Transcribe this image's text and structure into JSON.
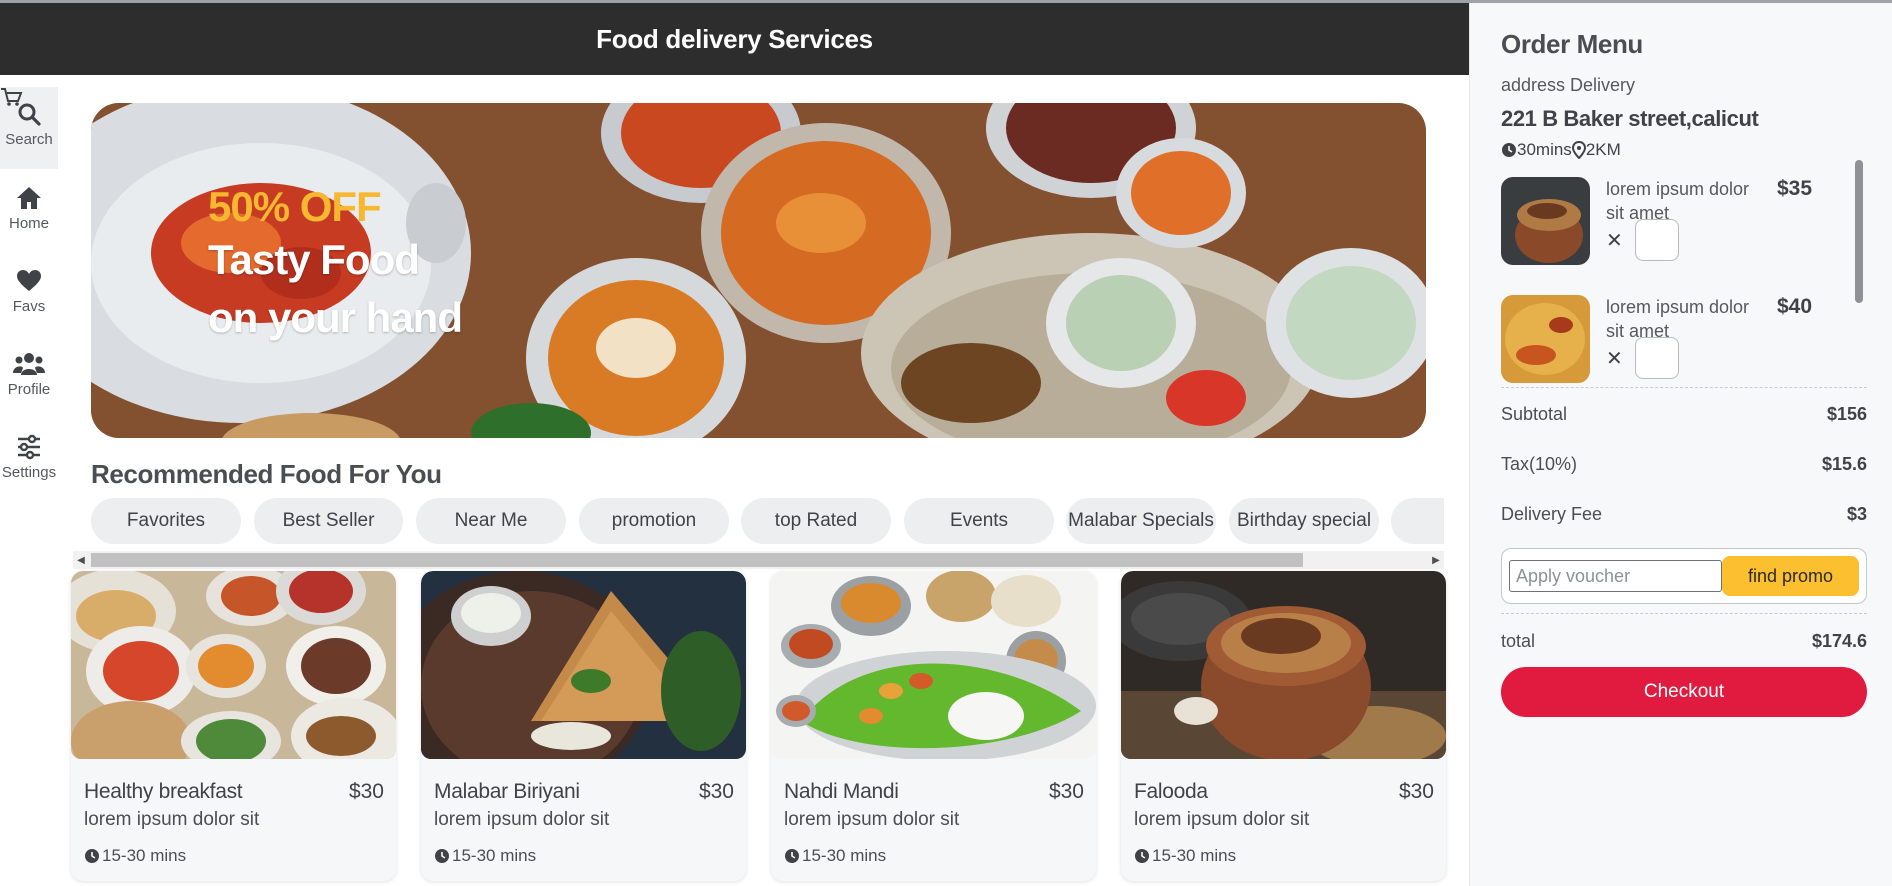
{
  "header": {
    "title": "Food delivery Services"
  },
  "nav": [
    {
      "label": "Search",
      "icon": "search-icon"
    },
    {
      "label": "Home",
      "icon": "home-icon"
    },
    {
      "label": "Favs",
      "icon": "heart-icon"
    },
    {
      "label": "Profile",
      "icon": "users-icon"
    },
    {
      "label": "Settings",
      "icon": "sliders-icon"
    }
  ],
  "banner": {
    "offer": "50% OFF",
    "line1": "Tasty Food",
    "line2": "on your hand"
  },
  "recommended": {
    "title": "Recommended Food For You",
    "categories": [
      "Favorites",
      "Best Seller",
      "Near Me",
      "promotion",
      "top Rated",
      "Events",
      "Malabar Specials",
      "Birthday special",
      ""
    ]
  },
  "foods": [
    {
      "name": "Healthy breakfast",
      "price": "$30",
      "desc": "lorem ipsum dolor sit",
      "time": "15-30 mins"
    },
    {
      "name": "Malabar Biriyani",
      "price": "$30",
      "desc": "lorem ipsum dolor sit",
      "time": "15-30 mins"
    },
    {
      "name": "Nahdi Mandi",
      "price": "$30",
      "desc": "lorem ipsum dolor sit",
      "time": "15-30 mins"
    },
    {
      "name": "Falooda",
      "price": "$30",
      "desc": "lorem ipsum dolor sit",
      "time": "15-30 mins"
    }
  ],
  "order": {
    "title": "Order Menu",
    "address_label": "address Delivery",
    "address": "221 B Baker street,calicut",
    "duration": "30mins",
    "distance": "2KM",
    "items": [
      {
        "name": "lorem ipsum dolor sit amet",
        "price": "$35"
      },
      {
        "name": "lorem ipsum dolor sit amet",
        "price": "$40"
      }
    ],
    "subtotal_label": "Subtotal",
    "subtotal": "$156",
    "tax_label": "Tax(10%)",
    "tax": "$15.6",
    "delivery_label": "Delivery Fee",
    "delivery": "$3",
    "voucher_placeholder": "Apply voucher",
    "promo_label": "find promo",
    "total_label": "total",
    "total": "$174.6",
    "checkout_label": "Checkout"
  },
  "colors": {
    "header_bg": "#2d2d2d",
    "accent_yellow": "#fbbf30",
    "checkout_red": "#e11a3f",
    "offer_gold": "#f7b731"
  }
}
